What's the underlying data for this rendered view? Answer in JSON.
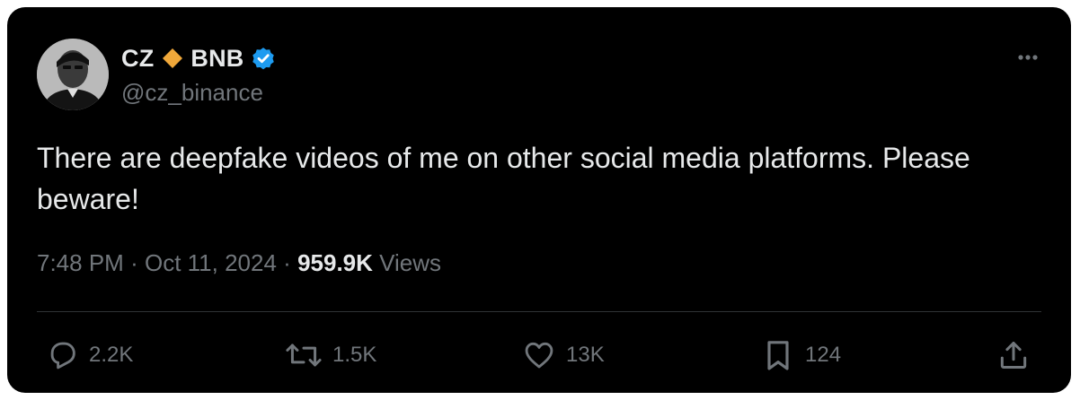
{
  "author": {
    "name": "CZ",
    "name_suffix": "BNB",
    "handle": "@cz_binance",
    "verified": true,
    "diamond_color": "#F0A83A",
    "verified_color": "#1D9BF0"
  },
  "tweet": {
    "text": "There are deepfake videos of me on other social media platforms. Please beware!",
    "time": "7:48 PM",
    "date": "Oct 11, 2024",
    "separator": "·",
    "views_count": "959.9K",
    "views_label": "Views"
  },
  "actions": {
    "replies": "2.2K",
    "reposts": "1.5K",
    "likes": "13K",
    "bookmarks": "124"
  },
  "icons": {
    "more": "more-horizontal-icon",
    "reply": "reply-icon",
    "repost": "repost-icon",
    "like": "heart-icon",
    "bookmark": "bookmark-icon",
    "share": "share-icon"
  },
  "colors": {
    "background": "#000000",
    "text_primary": "#e7e9ea",
    "text_secondary": "#71767b",
    "divider": "#2f3336"
  }
}
